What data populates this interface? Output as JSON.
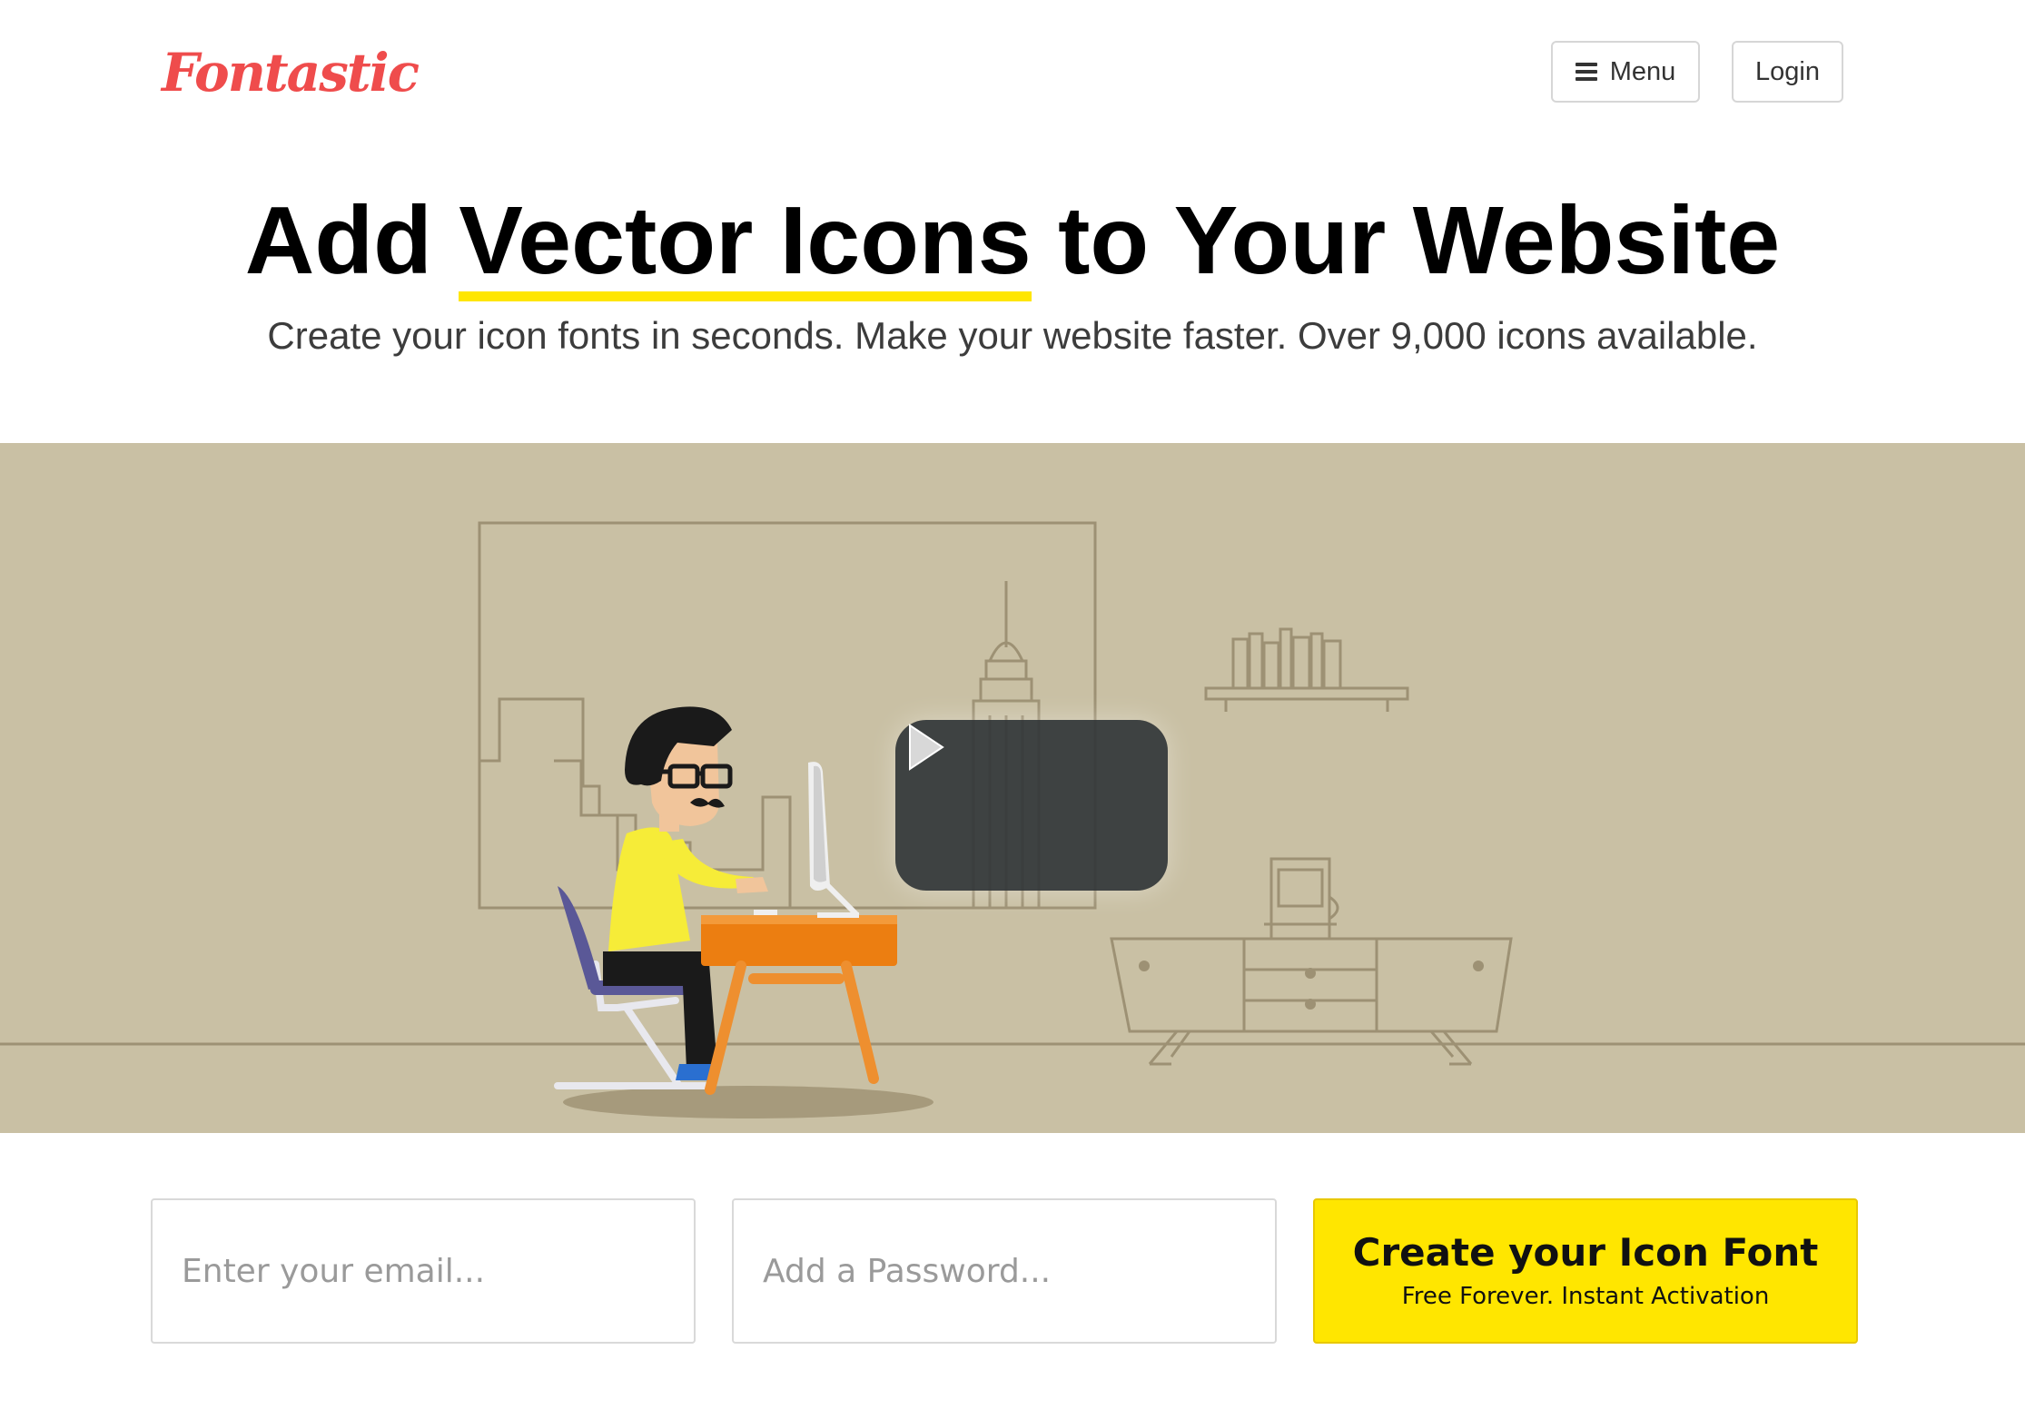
{
  "header": {
    "logo_text": "Fontastic",
    "menu_label": "Menu",
    "login_label": "Login"
  },
  "hero": {
    "headline_before": "Add ",
    "headline_highlight": "Vector Icons",
    "headline_after": " to Your Website",
    "subheadline": "Create your icon fonts in seconds. Make your website faster. Over 9,000 icons available."
  },
  "signup": {
    "email_placeholder": "Enter your email...",
    "password_placeholder": "Add a Password...",
    "cta_title": "Create your Icon Font",
    "cta_subtitle": "Free Forever. Instant Activation"
  },
  "icons": {
    "menu": "hamburger-icon",
    "video": "play-icon"
  },
  "colors": {
    "brand": "#ef4c4c",
    "accent": "#ffe600",
    "illustration_bg": "#c9c0a4",
    "play_button": "#34383a"
  }
}
